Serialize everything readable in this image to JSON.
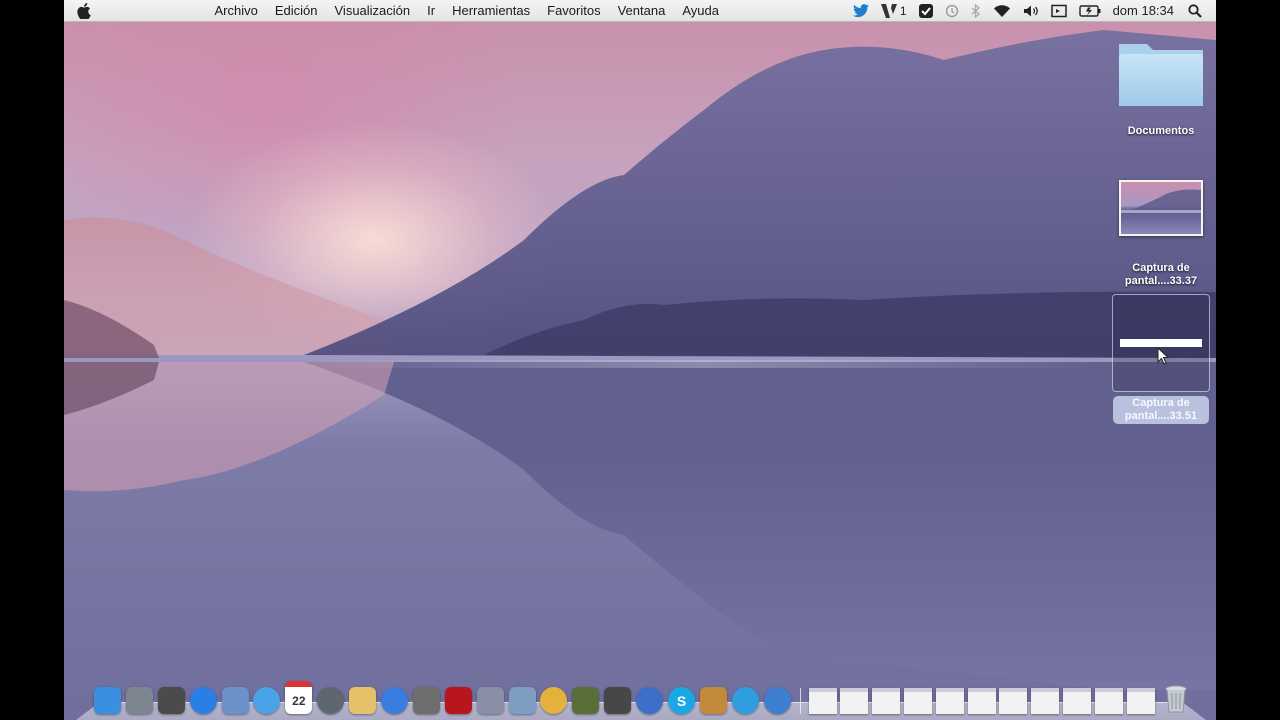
{
  "menubar": {
    "menus": [
      "Archivo",
      "Edición",
      "Visualización",
      "Ir",
      "Herramientas",
      "Favoritos",
      "Ventana",
      "Ayuda"
    ],
    "status": {
      "adobe_count": "1",
      "clock": "dom 18:34"
    },
    "icons": [
      "apple-icon",
      "twitter-icon",
      "adobe-icon",
      "evernote-icon",
      "time-machine-icon",
      "bluetooth-icon",
      "wifi-icon",
      "volume-icon",
      "screen-icon",
      "battery-icon",
      "spotlight-icon"
    ]
  },
  "desktop": {
    "items": [
      {
        "label": "Documentos",
        "type": "folder"
      },
      {
        "label": "Captura de pantal....33.37",
        "type": "screenshot"
      },
      {
        "label": "Captura de pantal....33.51",
        "type": "screenshot-selected"
      }
    ]
  },
  "dock": {
    "apps": [
      {
        "name": "finder",
        "icon": "finder-icon",
        "color": "#3b8fe0"
      },
      {
        "name": "launchpad",
        "icon": "launchpad-icon",
        "color": "#7d8591"
      },
      {
        "name": "dashboard",
        "icon": "dashboard-icon",
        "color": "#4b4b4b"
      },
      {
        "name": "app-store",
        "icon": "app-store-icon",
        "color": "#2a7fe6"
      },
      {
        "name": "preview",
        "icon": "preview-icon",
        "color": "#6b91c8"
      },
      {
        "name": "safari",
        "icon": "safari-icon",
        "color": "#4aa3e6"
      },
      {
        "name": "calendar",
        "icon": "calendar-icon",
        "color": "#ffffff",
        "text": "22"
      },
      {
        "name": "facetime",
        "icon": "facetime-icon",
        "color": "#5e6670"
      },
      {
        "name": "notes",
        "icon": "notes-icon",
        "color": "#e6c16a"
      },
      {
        "name": "itunes",
        "icon": "itunes-icon",
        "color": "#3a7de0"
      },
      {
        "name": "photo-booth",
        "icon": "photo-booth-icon",
        "color": "#6e6e6e"
      },
      {
        "name": "photo-app",
        "icon": "photo-app-icon",
        "color": "#b8161f"
      },
      {
        "name": "script-editor",
        "icon": "script-editor-icon",
        "color": "#8a8fa6"
      },
      {
        "name": "iphoto",
        "icon": "iphoto-icon",
        "color": "#7d9dc3"
      },
      {
        "name": "chrome",
        "icon": "chrome-icon",
        "color": "#e3b23c"
      },
      {
        "name": "imovie",
        "icon": "imovie-icon",
        "color": "#5a6e3a"
      },
      {
        "name": "pen-tool",
        "icon": "pen-icon",
        "color": "#474747"
      },
      {
        "name": "network",
        "icon": "globe-icon",
        "color": "#3e6fc8"
      },
      {
        "name": "skype",
        "icon": "skype-icon",
        "color": "#19a8e6",
        "text": "S"
      },
      {
        "name": "image-app",
        "icon": "image-app-icon",
        "color": "#c28a3a"
      },
      {
        "name": "twitter",
        "icon": "twitter-bird-icon",
        "color": "#2f9de0"
      },
      {
        "name": "quicktime",
        "icon": "quicktime-icon",
        "color": "#3d7fd1"
      }
    ],
    "minimized_count": 11
  }
}
